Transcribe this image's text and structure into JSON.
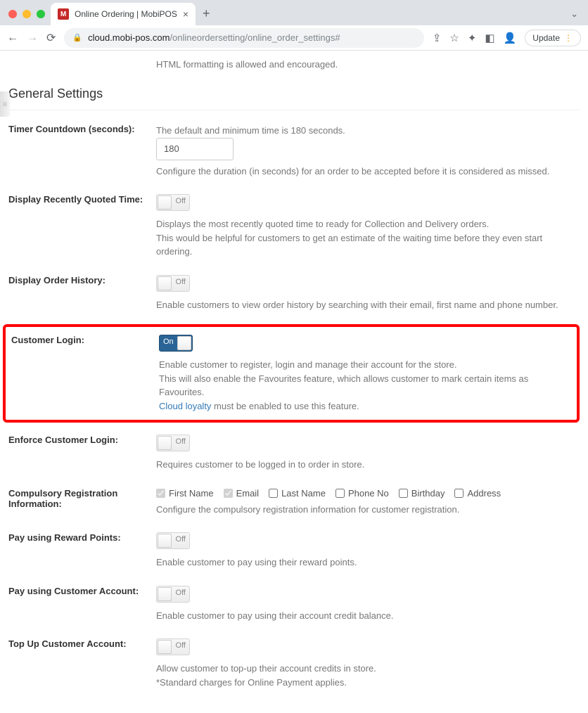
{
  "browser": {
    "tab_title": "Online Ordering | MobiPOS",
    "favicon_letter": "M",
    "url_host": "cloud.mobi-pos.com",
    "url_path": "/onlineordersetting/online_order_settings#",
    "update_label": "Update"
  },
  "page": {
    "html_note": "HTML formatting is allowed and encouraged.",
    "section_title": "General Settings"
  },
  "timer": {
    "label": "Timer Countdown (seconds):",
    "help_top": "The default and minimum time is 180 seconds.",
    "value": "180",
    "help_bottom": "Configure the duration (in seconds) for an order to be accepted before it is considered as missed."
  },
  "quoted_time": {
    "label": "Display Recently Quoted Time:",
    "state": "Off",
    "help1": "Displays the most recently quoted time to ready for Collection and Delivery orders.",
    "help2": "This would be helpful for customers to get an estimate of the waiting time before they even start ordering."
  },
  "order_history": {
    "label": "Display Order History:",
    "state": "Off",
    "help": "Enable customers to view order history by searching with their email, first name and phone number."
  },
  "customer_login": {
    "label": "Customer Login:",
    "state": "On",
    "help1": "Enable customer to register, login and manage their account for the store.",
    "help2": "This will also enable the Favourites feature, which allows customer to mark certain items as Favourites.",
    "link_text": "Cloud loyalty",
    "help3_tail": " must be enabled to use this feature."
  },
  "enforce_login": {
    "label": "Enforce Customer Login:",
    "state": "Off",
    "help": "Requires customer to be logged in to order in store."
  },
  "compulsory": {
    "label": "Compulsory Registration Information:",
    "options": {
      "first_name": "First Name",
      "email": "Email",
      "last_name": "Last Name",
      "phone": "Phone No",
      "birthday": "Birthday",
      "address": "Address"
    },
    "help": "Configure the compulsory registration information for customer registration."
  },
  "reward_points": {
    "label": "Pay using Reward Points:",
    "state": "Off",
    "help": "Enable customer to pay using their reward points."
  },
  "customer_account": {
    "label": "Pay using Customer Account:",
    "state": "Off",
    "help": "Enable customer to pay using their account credit balance."
  },
  "topup": {
    "label": "Top Up Customer Account:",
    "state": "Off",
    "help1": "Allow customer to top-up their account credits in store.",
    "help2": "*Standard charges for Online Payment applies."
  }
}
